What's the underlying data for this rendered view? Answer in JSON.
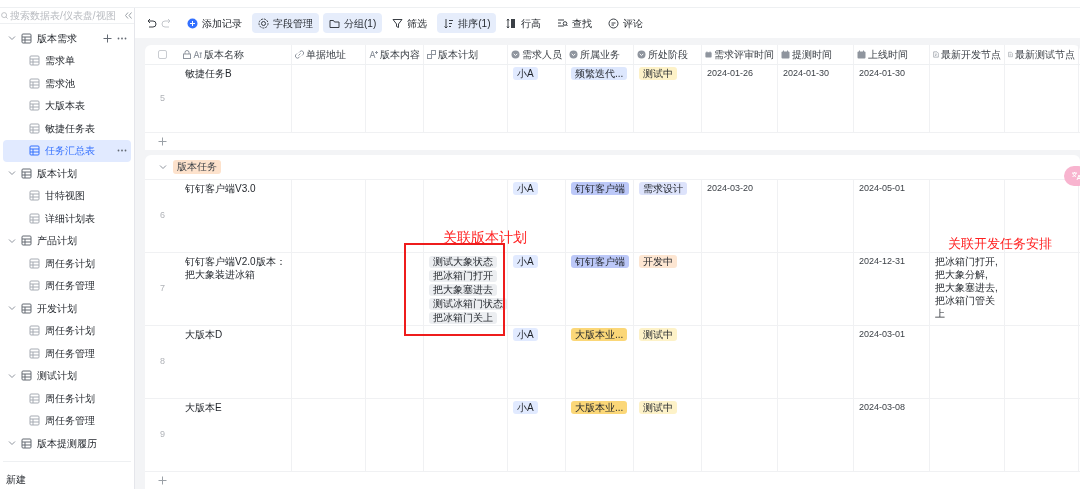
{
  "sidebar": {
    "search": {
      "placeholder": "搜索数据表/仪表盘/视图"
    },
    "items": [
      {
        "label": "版本需求",
        "expanded": true,
        "children": [
          {
            "label": "需求单",
            "selected": false
          },
          {
            "label": "需求池",
            "selected": false
          },
          {
            "label": "大版本表",
            "selected": false
          },
          {
            "label": "敏捷任务表",
            "selected": false
          },
          {
            "label": "任务汇总表",
            "selected": true
          }
        ]
      },
      {
        "label": "版本计划",
        "expanded": true,
        "children": [
          {
            "label": "甘特视图",
            "selected": false
          },
          {
            "label": "详细计划表",
            "selected": false
          }
        ]
      },
      {
        "label": "产品计划",
        "expanded": true,
        "children": [
          {
            "label": "周任务计划",
            "selected": false
          },
          {
            "label": "周任务管理",
            "selected": false
          }
        ]
      },
      {
        "label": "开发计划",
        "expanded": true,
        "children": [
          {
            "label": "周任务计划",
            "selected": false
          },
          {
            "label": "周任务管理",
            "selected": false
          }
        ]
      },
      {
        "label": "测试计划",
        "expanded": true,
        "children": [
          {
            "label": "周任务计划",
            "selected": false
          },
          {
            "label": "周任务管理",
            "selected": false
          }
        ]
      },
      {
        "label": "版本提测履历",
        "expanded": true
      }
    ],
    "new_button": "新建"
  },
  "toolbar": [
    {
      "label": "添加记录",
      "active": false
    },
    {
      "label": "字段管理",
      "active": true
    },
    {
      "label": "分组(1)",
      "active": true
    },
    {
      "label": "筛选",
      "active": false
    },
    {
      "label": "排序(1)",
      "active": true
    },
    {
      "label": "行高",
      "active": false
    },
    {
      "label": "查找",
      "active": false
    },
    {
      "label": "评论",
      "active": false
    }
  ],
  "table": {
    "columns": [
      "版本名称",
      "单据地址",
      "版本内容",
      "版本计划",
      "需求人员",
      "所属业务",
      "所处阶段",
      "需求评审时间",
      "提测时间",
      "上线时间",
      "最新开发节点",
      "最新测试节点"
    ],
    "select_all": {
      "checked": false
    },
    "groups": [
      {
        "rows": [
          {
            "number": "5",
            "name": "敏捷任务B",
            "requester": {
              "text": "小A",
              "color": "#e1eaff"
            },
            "business": {
              "text": "频繁迭代...",
              "color": "#dde7fd"
            },
            "stage": {
              "text": "测试中",
              "color": "#fdf2c8"
            },
            "review_date": "2024-01-26",
            "test_date": "2024-01-30",
            "launch_date": "2024-01-30"
          }
        ]
      },
      {
        "label": "版本任务",
        "expanded": true,
        "rows": [
          {
            "number": "6",
            "name": "钉钉客户端V3.0",
            "requester": {
              "text": "小A",
              "color": "#e1eaff"
            },
            "business": {
              "text": "钉钉客户端",
              "color": "#bcc8f8"
            },
            "stage": {
              "text": "需求设计",
              "color": "#dde3fb"
            },
            "review_date": "2024-03-20",
            "launch_date": "2024-05-01"
          },
          {
            "number": "7",
            "name": "钉钉客户端V2.0版本：把大象装进冰箱",
            "plan": [
              "测试大象状态",
              "把冰箱门打开",
              "把大象塞进去",
              "测试冰箱门状态",
              "把冰箱门关上"
            ],
            "requester": {
              "text": "小A",
              "color": "#e1eaff"
            },
            "business": {
              "text": "钉钉客户端",
              "color": "#bcc8f8"
            },
            "stage": {
              "text": "开发中",
              "color": "#fde6d2"
            },
            "launch_date": "2024-12-31",
            "dev_node": "把冰箱门打开, 把大象分解, 把大象塞进去, 把冰箱门管关上"
          },
          {
            "number": "8",
            "name": "大版本D",
            "requester": {
              "text": "小A",
              "color": "#e1eaff"
            },
            "business": {
              "text": "大版本业...",
              "color": "#fbd778"
            },
            "stage": {
              "text": "测试中",
              "color": "#fdf2c8"
            },
            "launch_date": "2024-03-01"
          },
          {
            "number": "9",
            "name": "大版本E",
            "requester": {
              "text": "小A",
              "color": "#e1eaff"
            },
            "business": {
              "text": "大版本业...",
              "color": "#fbd778"
            },
            "stage": {
              "text": "测试中",
              "color": "#fdf2c8"
            },
            "launch_date": "2024-03-08"
          }
        ]
      }
    ]
  },
  "annotations": [
    "关联版本计划",
    "关联开发任务安排"
  ]
}
